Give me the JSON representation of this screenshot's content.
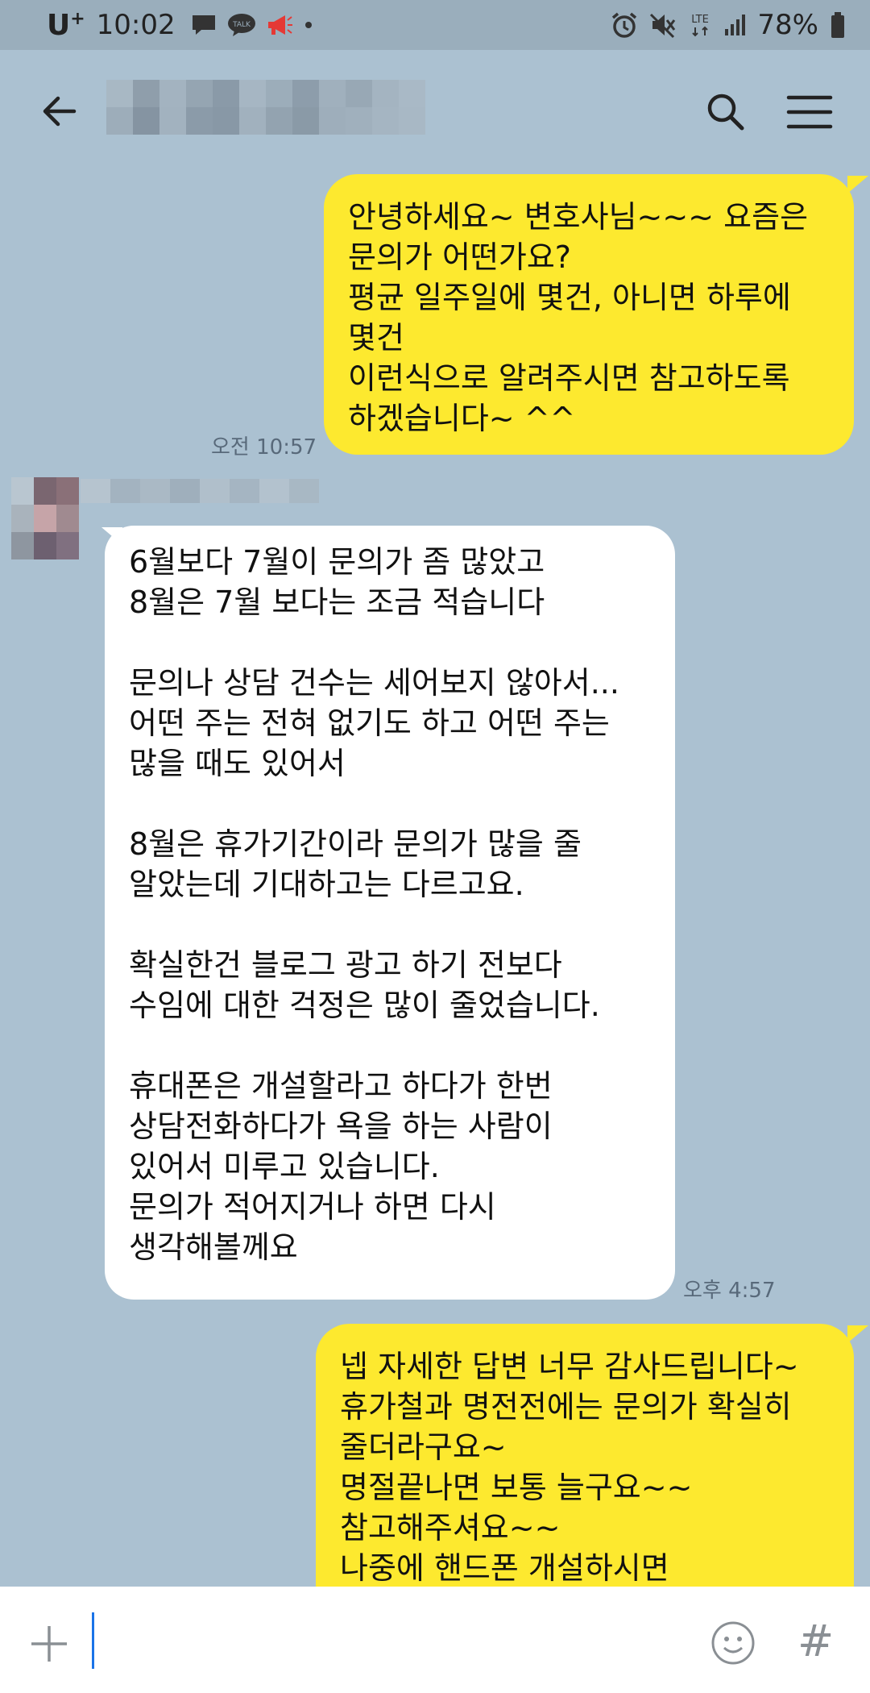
{
  "status_bar": {
    "carrier": "U",
    "carrier_sup": "+",
    "time": "10:02",
    "talk_label": "TALK",
    "network": "LTE",
    "battery": "78%"
  },
  "header": {
    "title": ""
  },
  "messages": [
    {
      "sender": "me",
      "text": "안녕하세요~ 변호사님~~~ 요즘은\n문의가 어떤가요?\n평균 일주일에 몇건, 아니면 하루에\n몇건\n이런식으로 알려주시면 참고하도록\n하겠습니다~ ^^",
      "time": "오전 10:57"
    },
    {
      "sender": "other",
      "text": "6월보다 7월이 문의가 좀 많았고\n8월은 7월 보다는 조금 적습니다\n\n문의나 상담 건수는 세어보지 않아서...\n어떤 주는 전혀 없기도 하고 어떤 주는\n많을 때도 있어서\n\n8월은 휴가기간이라 문의가 많을 줄\n알았는데 기대하고는 다르고요.\n\n확실한건 블로그 광고 하기 전보다\n수임에 대한 걱정은 많이 줄었습니다.\n\n휴대폰은 개설할라고 하다가 한번\n상담전화하다가 욕을 하는 사람이\n있어서 미루고 있습니다.\n문의가 적어지거나 하면 다시\n생각해볼께요",
      "time": "오후 4:57"
    },
    {
      "sender": "me",
      "text": "넵 자세한 답변 너무 감사드립니다~\n휴가철과 명전전에는 문의가 확실히\n줄더라구요~\n명절끝나면 보통 늘구요~~\n참고해주셔요~~\n나중에 핸드폰 개설하시면",
      "time": ""
    }
  ],
  "input": {
    "value": "",
    "hash_label": "#"
  },
  "colors": {
    "background": "#abc1d1",
    "my_bubble": "#fde92f",
    "their_bubble": "#ffffff",
    "status_bar": "#9aaebc"
  },
  "icons": {
    "back": "arrow-left-icon",
    "search": "search-icon",
    "menu": "hamburger-menu-icon",
    "plus": "plus-icon",
    "emoji": "smiley-icon",
    "hash": "hash-icon"
  }
}
